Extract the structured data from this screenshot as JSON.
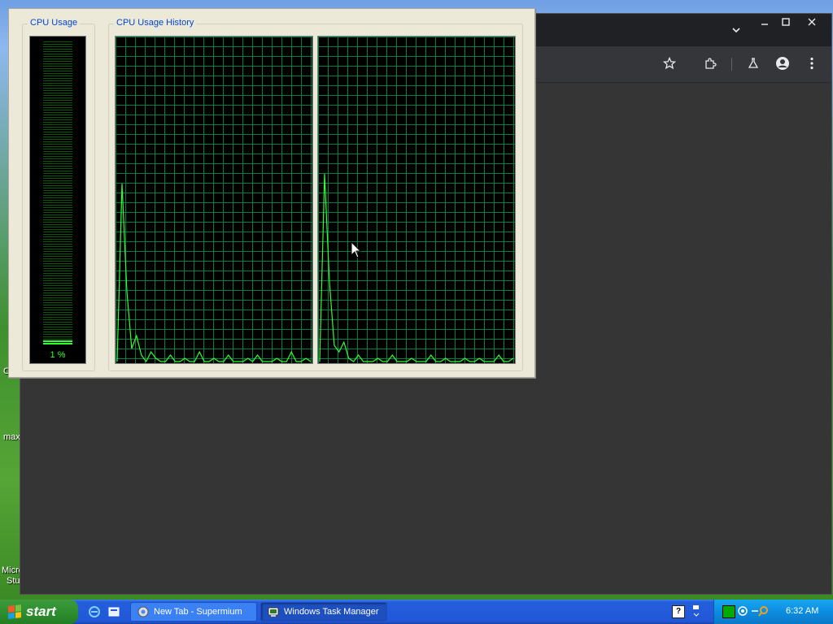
{
  "desktop": {
    "labels": [
      "C",
      "max",
      "Micro",
      "Stu"
    ]
  },
  "browser": {
    "icons": {
      "tab_menu": "chevron-down-icon",
      "minimize": "minimize-icon",
      "maximize": "maximize-icon",
      "close": "close-icon",
      "bookmark": "star-icon",
      "extensions": "puzzle-icon",
      "labs": "flask-icon",
      "profile": "person-icon",
      "menu": "kebab-menu-icon"
    }
  },
  "task_manager": {
    "cpu_usage_title": "CPU Usage",
    "cpu_history_title": "CPU Usage History",
    "cpu_percent": "1 %",
    "cpu_level": 0.01,
    "graph_color": "#30ff30",
    "grid_color": "#008040"
  },
  "taskbar": {
    "start_label": "start",
    "quick_launch": [
      "ie-icon",
      "explorer-icon"
    ],
    "tasks": [
      {
        "label": "New Tab - Supermium",
        "icon": "browser-icon",
        "active": false
      },
      {
        "label": "Windows Task Manager",
        "icon": "taskmgr-icon",
        "active": true
      }
    ],
    "tray": {
      "icons": [
        "help-icon",
        "network-icon",
        "cpu-meter-icon",
        "network2-icon",
        "search-icon"
      ],
      "clock": "6:32 AM"
    }
  },
  "chart_data": [
    {
      "type": "line",
      "title": "CPU Usage History",
      "series": [
        {
          "values": [
            0,
            55,
            22,
            4,
            8,
            2,
            0,
            3,
            1,
            0,
            0,
            2,
            0,
            0,
            1,
            0,
            0,
            3,
            0,
            0,
            1,
            0,
            0,
            2,
            0,
            0,
            0,
            1,
            0,
            2,
            0,
            0,
            0,
            1,
            0,
            0,
            3,
            0,
            0,
            1,
            0
          ]
        }
      ],
      "ylim": [
        0,
        100
      ],
      "grid": true
    },
    {
      "type": "line",
      "title": "CPU Usage History",
      "series": [
        {
          "values": [
            0,
            58,
            25,
            5,
            3,
            6,
            1,
            0,
            2,
            0,
            0,
            0,
            1,
            0,
            0,
            2,
            0,
            0,
            0,
            1,
            0,
            0,
            0,
            2,
            0,
            0,
            1,
            0,
            0,
            0,
            1,
            0,
            0,
            1,
            0,
            0,
            0,
            2,
            0,
            0,
            1
          ]
        }
      ],
      "ylim": [
        0,
        100
      ],
      "grid": true
    }
  ]
}
